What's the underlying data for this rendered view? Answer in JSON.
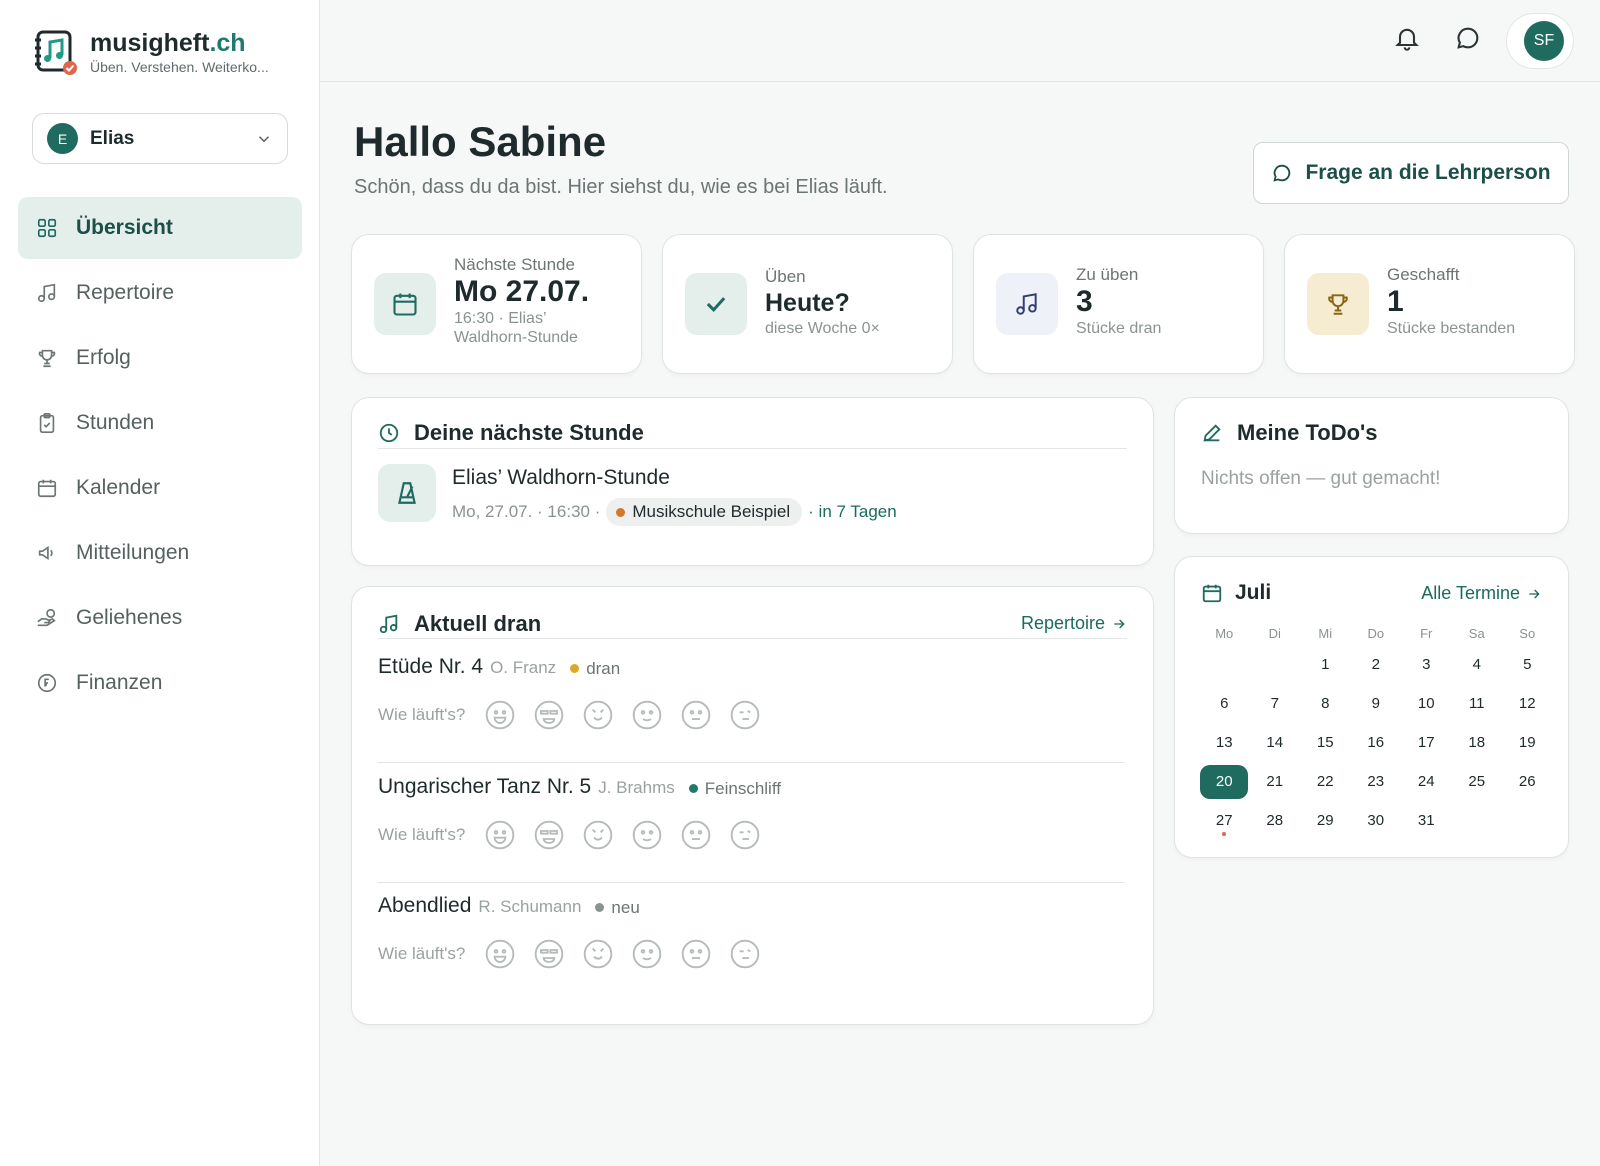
{
  "brand": {
    "name": "musigheft",
    "tld": ".ch",
    "tagline": "Üben. Verstehen. Weiterko..."
  },
  "student_selector": {
    "initial": "E",
    "name": "Elias"
  },
  "sidebar": {
    "items": [
      {
        "label": "Übersicht",
        "icon": "grid-icon",
        "active": true
      },
      {
        "label": "Repertoire",
        "icon": "music-note-icon"
      },
      {
        "label": "Erfolg",
        "icon": "trophy-icon"
      },
      {
        "label": "Stunden",
        "icon": "clipboard-check-icon"
      },
      {
        "label": "Kalender",
        "icon": "calendar-icon"
      },
      {
        "label": "Mitteilungen",
        "icon": "megaphone-icon"
      },
      {
        "label": "Geliehenes",
        "icon": "hand-coin-icon"
      },
      {
        "label": "Finanzen",
        "icon": "franc-coin-icon"
      }
    ]
  },
  "topbar": {
    "user_initials": "SF"
  },
  "header": {
    "title": "Hallo Sabine",
    "subtitle": "Schön, dass du da bist. Hier siehst du, wie es bei Elias läuft.",
    "ask_button": "Frage an die Lehrperson"
  },
  "stats": [
    {
      "label": "Nächste Stunde",
      "value": "Mo 27.07.",
      "sub": "16:30 · Elias’ Waldhorn-Stunde",
      "icon": "calendar-icon",
      "color": "#e4efec"
    },
    {
      "label": "Üben",
      "value": "Heute?",
      "sub": "diese Woche 0×",
      "icon": "check-icon",
      "color": "#e4efec"
    },
    {
      "label": "Zu üben",
      "value": "3",
      "sub": "Stücke dran",
      "icon": "music-note-icon",
      "color": "#eef1f8"
    },
    {
      "label": "Geschafft",
      "value": "1",
      "sub": "Stücke bestanden",
      "icon": "trophy-icon",
      "color": "#f5ecd2"
    }
  ],
  "next_lesson": {
    "title": "Deine nächste Stunde",
    "name": "Elias’ Waldhorn-Stunde",
    "when": "Mo, 27.07. · 16:30 ·",
    "school": "Musikschule Beispiel",
    "school_color": "#d4772c",
    "relative": "· in 7 Tagen"
  },
  "current": {
    "title": "Aktuell dran",
    "link": "Repertoire",
    "rate_label": "Wie läuft's?",
    "pieces": [
      {
        "title": "Etüde Nr. 4",
        "composer": "O. Franz",
        "status": "dran",
        "status_color": "#d9a927"
      },
      {
        "title": "Ungarischer Tanz Nr. 5",
        "composer": "J. Brahms",
        "status": "Feinschliff",
        "status_color": "#1f7a6e"
      },
      {
        "title": "Abendlied",
        "composer": "R. Schumann",
        "status": "neu",
        "status_color": "#8a9392"
      }
    ]
  },
  "todos": {
    "title": "Meine ToDo's",
    "empty": "Nichts offen — gut gemacht!"
  },
  "calendar": {
    "month": "Juli",
    "link": "Alle Termine",
    "weekdays": [
      "Mo",
      "Di",
      "Mi",
      "Do",
      "Fr",
      "Sa",
      "So"
    ],
    "offset": 2,
    "days": 31,
    "today": 20,
    "event_days": [
      27
    ]
  }
}
